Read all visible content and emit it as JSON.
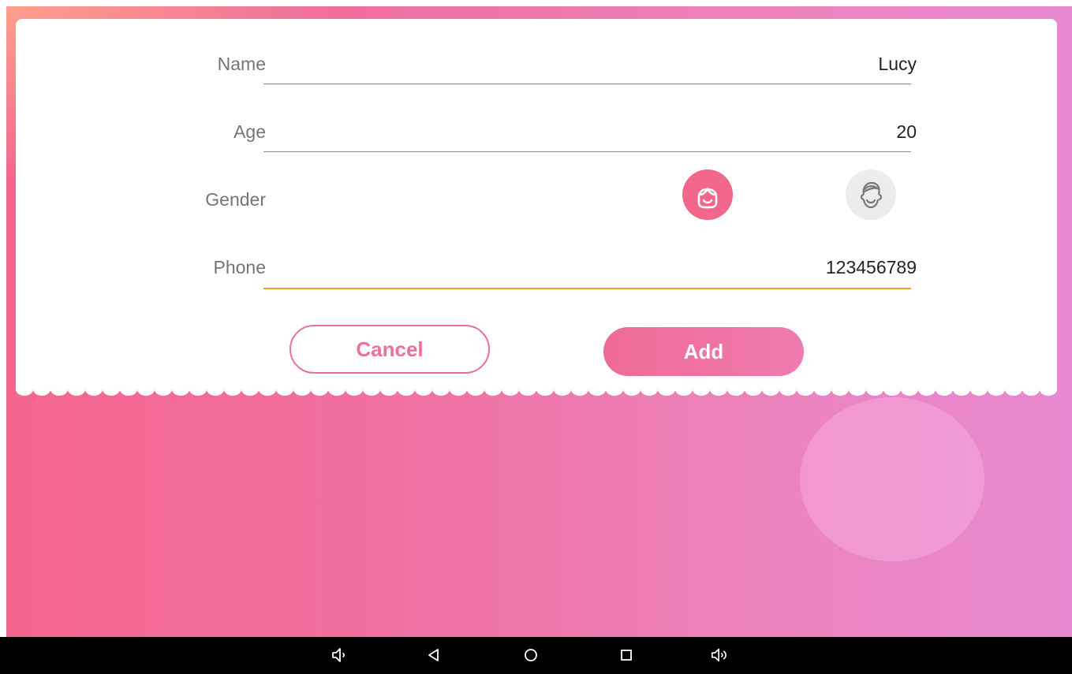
{
  "form": {
    "name": {
      "label": "Name",
      "value": "Lucy"
    },
    "age": {
      "label": "Age",
      "value": "20"
    },
    "gender": {
      "label": "Gender",
      "selected": "female",
      "female_icon": "female-face-icon",
      "male_icon": "male-face-icon"
    },
    "phone": {
      "label": "Phone",
      "value": "123456789"
    }
  },
  "buttons": {
    "cancel_label": "Cancel",
    "add_label": "Add"
  },
  "navbar": {
    "icons": [
      "volume-down-icon",
      "back-icon",
      "home-icon",
      "recents-icon",
      "volume-up-icon"
    ]
  },
  "colors": {
    "accent": "#f4678c",
    "focus_underline": "#f0a020",
    "navbar": "#000000"
  }
}
